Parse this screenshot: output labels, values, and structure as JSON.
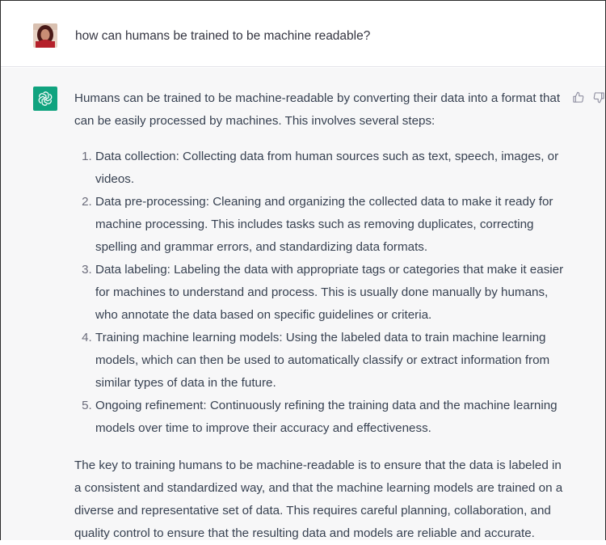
{
  "user": {
    "question": "how can humans be trained to be machine readable?"
  },
  "assistant": {
    "intro": "Humans can be trained to be machine-readable by converting their data into a format that can be easily processed by machines. This involves several steps:",
    "steps": [
      "Data collection: Collecting data from human sources such as text, speech, images, or videos.",
      "Data pre-processing: Cleaning and organizing the collected data to make it ready for machine processing. This includes tasks such as removing duplicates, correcting spelling and grammar errors, and standardizing data formats.",
      "Data labeling: Labeling the data with appropriate tags or categories that make it easier for machines to understand and process. This is usually done manually by humans, who annotate the data based on specific guidelines or criteria.",
      "Training machine learning models: Using the labeled data to train machine learning models, which can then be used to automatically classify or extract information from similar types of data in the future.",
      "Ongoing refinement: Continuously refining the training data and the machine learning models over time to improve their accuracy and effectiveness."
    ],
    "conclusion": "The key to training humans to be machine-readable is to ensure that the data is labeled in a consistent and standardized way, and that the machine learning models are trained on a diverse and representative set of data. This requires careful planning, collaboration, and quality control to ensure that the resulting data and models are reliable and accurate."
  },
  "icons": {
    "user_avatar": "user-avatar",
    "assistant_logo": "openai-logo-icon",
    "thumbs_up": "thumbs-up-icon",
    "thumbs_down": "thumbs-down-icon"
  },
  "colors": {
    "assistant_bg": "#f7f7f8",
    "logo_bg": "#10a37f",
    "text": "#374151"
  }
}
